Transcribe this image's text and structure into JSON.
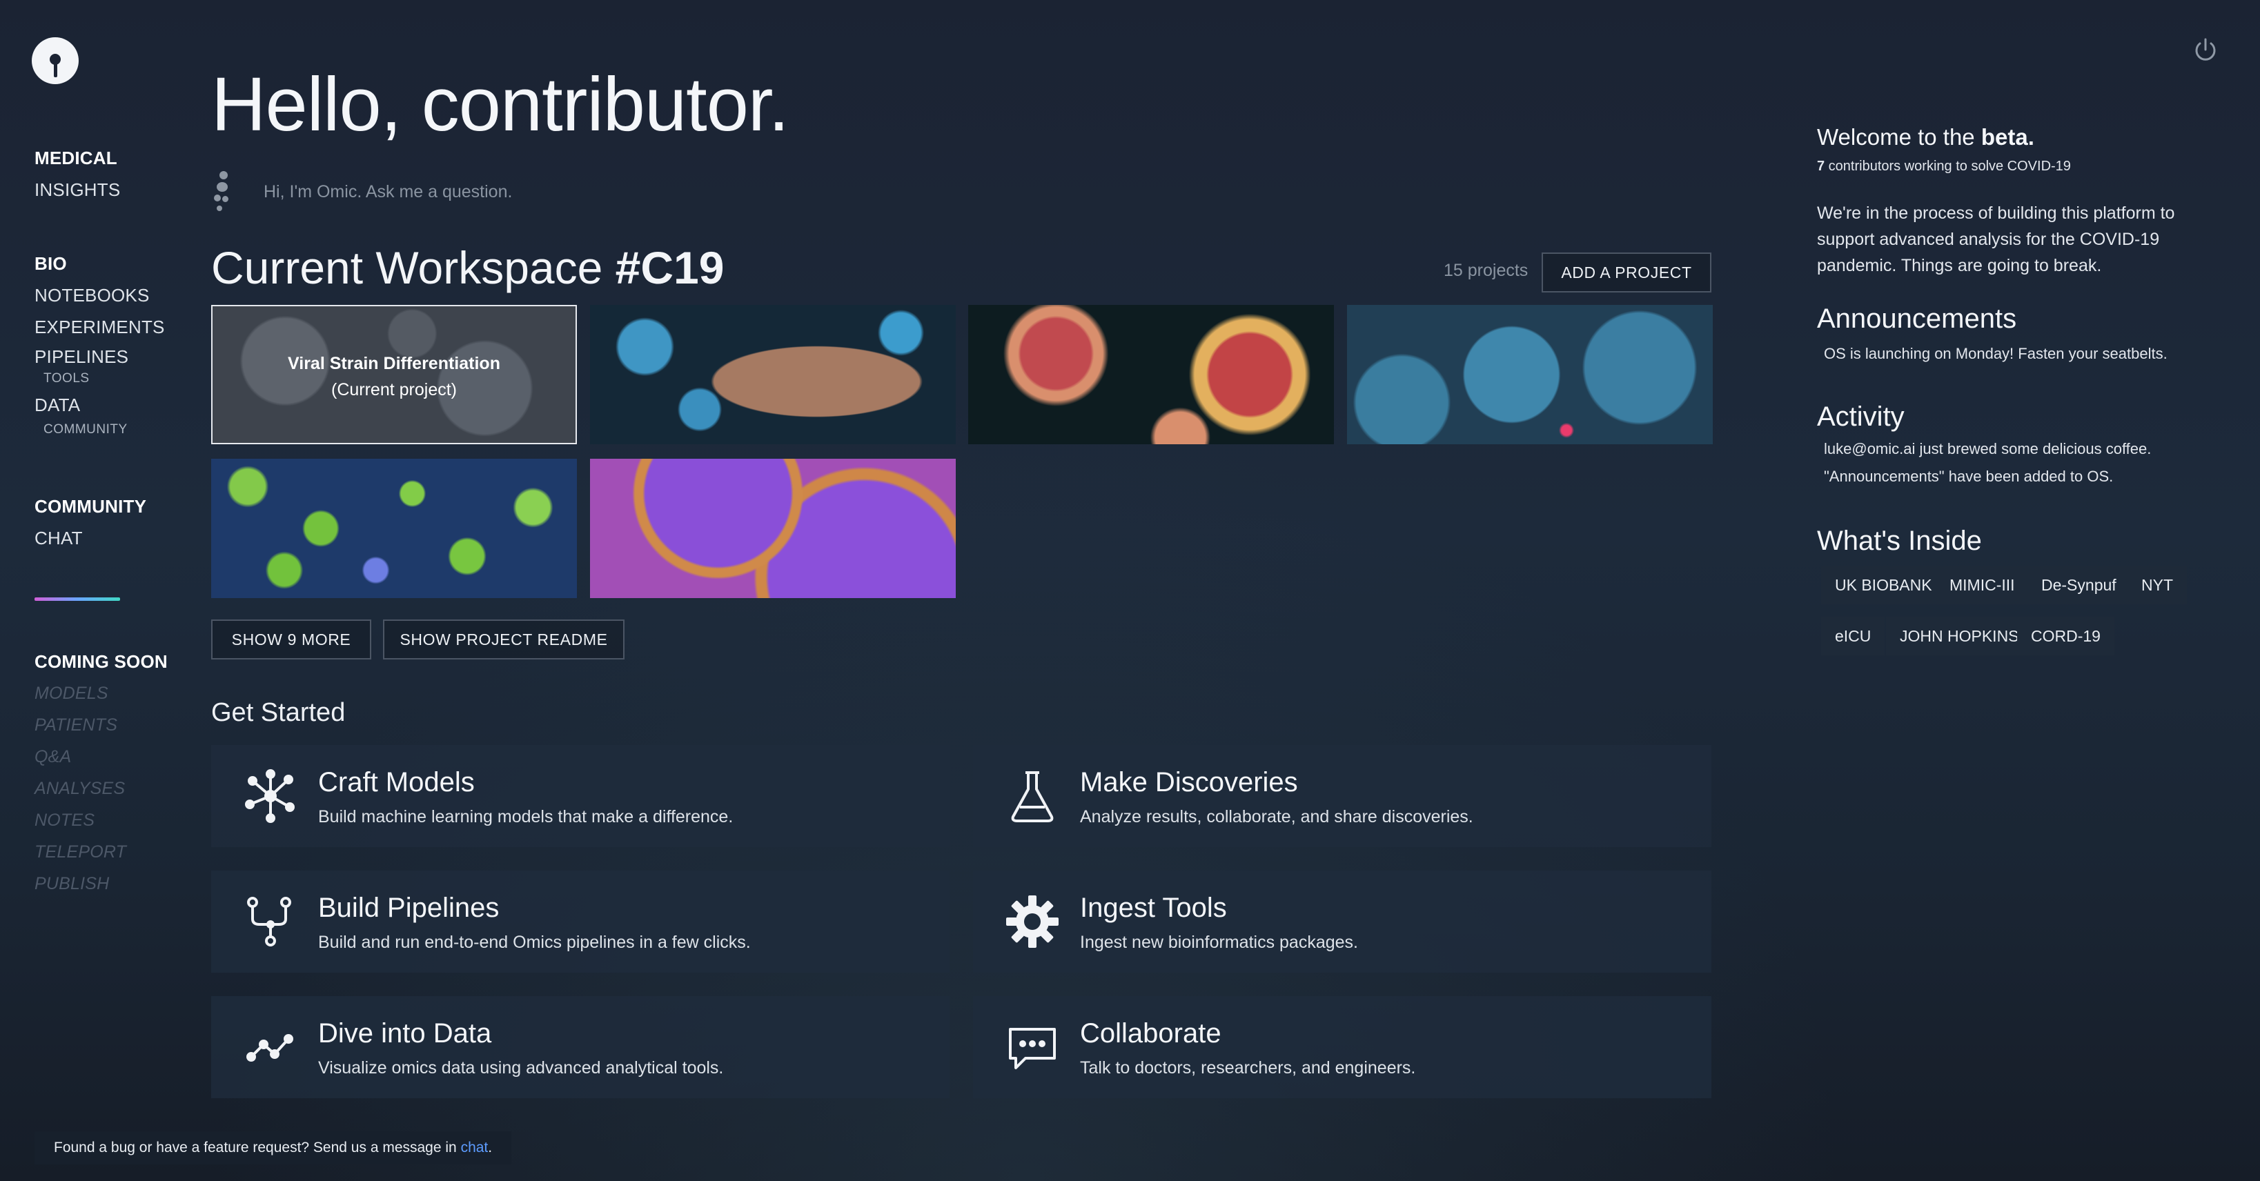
{
  "greeting": "Hello, contributor.",
  "assistant": {
    "placeholder": "Hi, I'm Omic. Ask me a question."
  },
  "sidebar": {
    "sections": [
      {
        "head": "MEDICAL",
        "items": [
          "INSIGHTS"
        ]
      },
      {
        "head": "BIO",
        "items": [
          "NOTEBOOKS",
          "EXPERIMENTS",
          "PIPELINES"
        ],
        "sub": [
          "TOOLS"
        ],
        "data": "DATA",
        "data_sub": "COMMUNITY"
      },
      {
        "head": "COMMUNITY",
        "items": [
          "CHAT"
        ]
      }
    ],
    "coming_soon": {
      "head": "COMING SOON",
      "items": [
        "MODELS",
        "PATIENTS",
        "Q&A",
        "ANALYSES",
        "NOTES",
        "TELEPORT",
        "PUBLISH"
      ]
    }
  },
  "workspace": {
    "title_prefix": "Current Workspace",
    "title_tag": "#C19",
    "project_count": "15 projects",
    "add_button": "ADD A PROJECT",
    "current_project": {
      "name": "Viral Strain Differentiation",
      "note": "(Current project)"
    },
    "show_more": "SHOW 9 MORE",
    "show_readme": "SHOW PROJECT README"
  },
  "get_started": {
    "title": "Get Started",
    "cards": [
      {
        "icon": "network-icon",
        "title": "Craft Models",
        "desc": "Build machine learning models that make a difference."
      },
      {
        "icon": "flask-icon",
        "title": "Make Discoveries",
        "desc": "Analyze results, collaborate, and share discoveries."
      },
      {
        "icon": "pipeline-icon",
        "title": "Build Pipelines",
        "desc": "Build and run end-to-end Omics pipelines in a few clicks."
      },
      {
        "icon": "gear-icon",
        "title": "Ingest Tools",
        "desc": "Ingest new bioinformatics packages."
      },
      {
        "icon": "line-chart-icon",
        "title": "Dive into Data",
        "desc": "Visualize omics data using advanced analytical tools."
      },
      {
        "icon": "chat-icon",
        "title": "Collaborate",
        "desc": "Talk to doctors, researchers, and engineers."
      }
    ]
  },
  "right": {
    "welcome_prefix": "Welcome to the ",
    "welcome_bold": "beta.",
    "contributors_num": "7",
    "contributors_text": " contributors working to solve COVID-19",
    "blurb": "We're in the process of building this platform to support advanced analysis for the COVID-19 pandemic. Things are going to break.",
    "announcements_title": "Announcements",
    "announcement": "OS is launching on Monday! Fasten your seatbelts.",
    "activity_title": "Activity",
    "activity": [
      "luke@omic.ai just brewed some delicious coffee.",
      "\"Announcements\" have been added to OS."
    ],
    "inside_title": "What's Inside",
    "inside": [
      "UK BIOBANK",
      "MIMIC-III",
      "De-Synpuf",
      "NYT",
      "eICU",
      "JOHN HOPKINS",
      "CORD-19"
    ]
  },
  "footer": {
    "text": "Found a bug or have a feature request? Send us a message in ",
    "link": "chat",
    "end": "."
  }
}
